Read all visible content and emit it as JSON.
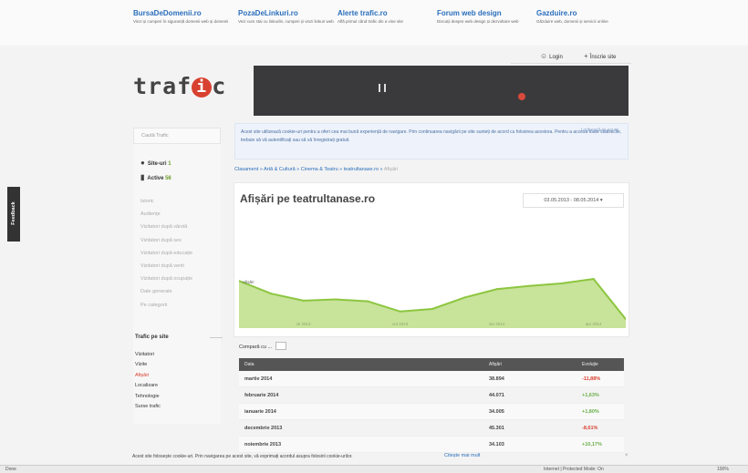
{
  "network_sites": [
    {
      "name": "BursaDeDomenii.ro",
      "desc": "Vinzi și cumperi în siguranță domenii web și domenii"
    },
    {
      "name": "PozaDeLinkuri.ro",
      "desc": "Vezi cum stai cu linkurile, cumperi și vinzi linkuri web"
    },
    {
      "name": "Alerte trafic.ro",
      "desc": "Află primul când trafic din a vine site"
    },
    {
      "name": "Forum web design",
      "desc": "Discuții despre web design și dezvoltare web"
    },
    {
      "name": "Gazduire.ro",
      "desc": "Găzduire web, domenii și servicii online"
    }
  ],
  "auth": {
    "login": "Login",
    "register": "Înscrie site"
  },
  "logo": {
    "before": "traf",
    "dot": "i",
    "after": "c"
  },
  "sidebar": {
    "search_placeholder": "Caută Trafic",
    "sites_label": "Site-uri",
    "sites_count": "1",
    "active_label": "Active",
    "active_count": "56",
    "nav": [
      "Istoric",
      "Audiențe",
      "Vizitatori după vârstă",
      "Vizitatori după sex",
      "Vizitatori după educație",
      "Vizitatori după venit",
      "Vizitatori după ocupație",
      "Date generale",
      "Pe categorii"
    ],
    "section_title": "Trafic pe site",
    "nav2": [
      "Vizitatori",
      "Vizite",
      "Afișări",
      "Localizare",
      "Tehnologie",
      "Surse trafic"
    ],
    "nav2_active": "Afișări"
  },
  "notice": {
    "text": "Acest site utilizează cookie-uri pentru a oferi cea mai bună experiență de navigare. Prin continuarea navigării pe site sunteți de acord cu folosirea acestora. Pentru a accesa toate statisticile, trebuie să vă autentificați sau să vă înregistrați gratuit.",
    "login": "Loghează-te acum"
  },
  "breadcrumb": [
    "Clasament",
    "Artă & Cultură",
    "Cinema & Teatru",
    "teatrultanase.ro",
    "Afișări"
  ],
  "chart_title": "Afișări pe teatrultanase.ro",
  "date_range": "03.05.2013 - 08.05.2014",
  "chart_data": {
    "type": "area",
    "x": [
      "mai 2013",
      "iun 2013",
      "iul 2013",
      "aug 2013",
      "sep 2013",
      "oct 2013",
      "nov 2013",
      "dec 2013",
      "ian 2014",
      "feb 2014",
      "mar 2014",
      "apr 2014",
      "mai 2014"
    ],
    "values": [
      74,
      54,
      43,
      45,
      42,
      26,
      30,
      48,
      61,
      66,
      70,
      77,
      14
    ],
    "x_ticks": [
      "iul 2013",
      "oct 2013",
      "ian 2014",
      "apr 2014"
    ],
    "ylim": [
      0,
      100
    ],
    "point_label": "Afișări",
    "color": "#8cc63f"
  },
  "compare": {
    "label": "Compară cu",
    "value": "..."
  },
  "table": {
    "headers": [
      "Data",
      "Afișări",
      "Evoluție"
    ],
    "rows": [
      [
        "martie 2014",
        "38.894",
        "-11,88%"
      ],
      [
        "februarie 2014",
        "44.071",
        "+1,63%"
      ],
      [
        "ianuarie 2014",
        "34.005",
        "+1,80%"
      ],
      [
        "decembrie 2013",
        "45.301",
        "-8,61%"
      ],
      [
        "noiembrie 2013",
        "34.103",
        "+10,17%"
      ]
    ]
  },
  "cookie_bar": {
    "message": "Acest site folosește cookie-uri. Prin navigarea pe acest site, vă exprimați acordul asupra folosirii cookie-urilor.",
    "button": "Citește mai mult",
    "close": "×"
  },
  "status_bar": {
    "left": "Done",
    "zone": "Internet | Protected Mode: On",
    "zoom": "100%"
  },
  "feedback": "Feedback"
}
